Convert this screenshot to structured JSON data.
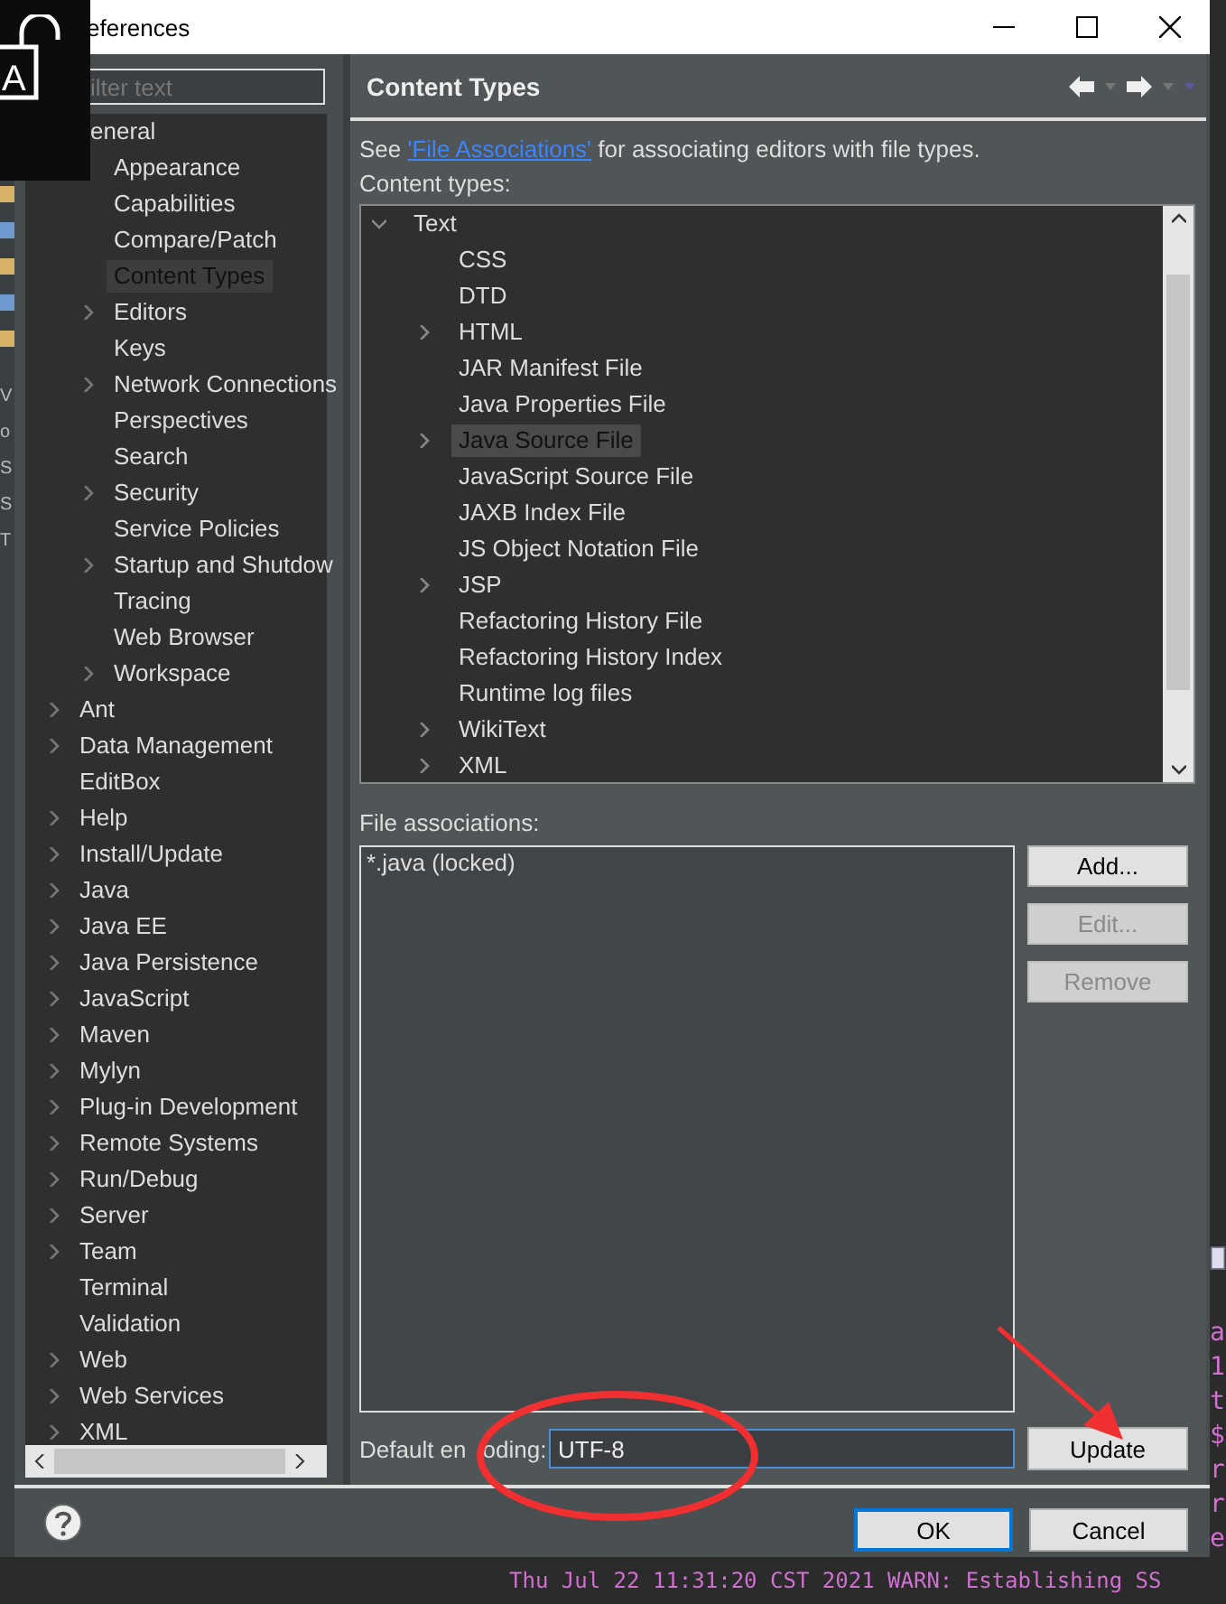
{
  "window": {
    "title": "eferences"
  },
  "overlay": {
    "letter": "A"
  },
  "left_edge_texts": [
    "V",
    "o",
    "S",
    "S",
    "T"
  ],
  "right_edge_texts": [
    "a",
    "1",
    "t",
    "$",
    "r",
    "r",
    "e"
  ],
  "console_line": "Thu Jul 22 11:31:20 CST 2021 WARN: Establishing SS",
  "filter": {
    "placeholder": "ilter text"
  },
  "settings_tree": [
    {
      "label": "eneral",
      "selected": false,
      "children": [
        {
          "label": "Appearance",
          "selected": false
        },
        {
          "label": "Capabilities",
          "selected": false
        },
        {
          "label": "Compare/Patch",
          "selected": false
        },
        {
          "label": "Content Types",
          "selected": true
        },
        {
          "label": "Editors",
          "expanded": false,
          "selected": false
        },
        {
          "label": "Keys",
          "selected": false
        },
        {
          "label": "Network Connections",
          "expanded": false,
          "selected": false
        },
        {
          "label": "Perspectives",
          "selected": false
        },
        {
          "label": "Search",
          "selected": false
        },
        {
          "label": "Security",
          "expanded": false,
          "selected": false
        },
        {
          "label": "Service Policies",
          "selected": false
        },
        {
          "label": "Startup and Shutdow",
          "expanded": false,
          "selected": false
        },
        {
          "label": "Tracing",
          "selected": false
        },
        {
          "label": "Web Browser",
          "selected": false
        },
        {
          "label": "Workspace",
          "expanded": false,
          "selected": false
        }
      ]
    },
    {
      "label": "Ant",
      "expanded": false,
      "selected": false
    },
    {
      "label": "Data Management",
      "expanded": false,
      "selected": false
    },
    {
      "label": "EditBox",
      "selected": false
    },
    {
      "label": "Help",
      "expanded": false,
      "selected": false
    },
    {
      "label": "Install/Update",
      "expanded": false,
      "selected": false
    },
    {
      "label": "Java",
      "expanded": false,
      "selected": false
    },
    {
      "label": "Java EE",
      "expanded": false,
      "selected": false
    },
    {
      "label": "Java Persistence",
      "expanded": false,
      "selected": false
    },
    {
      "label": "JavaScript",
      "expanded": false,
      "selected": false
    },
    {
      "label": "Maven",
      "expanded": false,
      "selected": false
    },
    {
      "label": "Mylyn",
      "expanded": false,
      "selected": false
    },
    {
      "label": "Plug-in Development",
      "expanded": false,
      "selected": false
    },
    {
      "label": "Remote Systems",
      "expanded": false,
      "selected": false
    },
    {
      "label": "Run/Debug",
      "expanded": false,
      "selected": false
    },
    {
      "label": "Server",
      "expanded": false,
      "selected": false
    },
    {
      "label": "Team",
      "expanded": false,
      "selected": false
    },
    {
      "label": "Terminal",
      "selected": false
    },
    {
      "label": "Validation",
      "selected": false
    },
    {
      "label": "Web",
      "expanded": false,
      "selected": false
    },
    {
      "label": "Web Services",
      "expanded": false,
      "selected": false
    },
    {
      "label": "XML",
      "expanded": false,
      "selected": false
    }
  ],
  "page": {
    "title": "Content Types",
    "intro": {
      "before": "See ",
      "link": "'File Associations'",
      "after": " for associating editors with file types."
    },
    "content_types_label": "Content types:",
    "content_types": [
      {
        "label": "Text",
        "expanded": true,
        "selected": false,
        "children": [
          {
            "label": "CSS",
            "selected": false
          },
          {
            "label": "DTD",
            "selected": false
          },
          {
            "label": "HTML",
            "expanded": false,
            "selected": false
          },
          {
            "label": "JAR Manifest File",
            "selected": false
          },
          {
            "label": "Java Properties File",
            "selected": false
          },
          {
            "label": "Java Source File",
            "expanded": false,
            "selected": true
          },
          {
            "label": "JavaScript Source File",
            "selected": false
          },
          {
            "label": "JAXB Index File",
            "selected": false
          },
          {
            "label": "JS Object Notation File",
            "selected": false
          },
          {
            "label": "JSP",
            "expanded": false,
            "selected": false
          },
          {
            "label": "Refactoring History File",
            "selected": false
          },
          {
            "label": "Refactoring History Index",
            "selected": false
          },
          {
            "label": "Runtime log files",
            "selected": false
          },
          {
            "label": "WikiText",
            "expanded": false,
            "selected": false
          },
          {
            "label": "XML",
            "expanded": false,
            "selected": false
          }
        ]
      }
    ],
    "file_associations_label": "File associations:",
    "file_associations": [
      "*.java (locked)"
    ],
    "side_buttons": [
      {
        "label": "Add...",
        "disabled": false
      },
      {
        "label": "Edit...",
        "disabled": true
      },
      {
        "label": "Remove",
        "disabled": true
      }
    ],
    "encoding": {
      "label_parts": [
        "Default en",
        "oding:"
      ],
      "value": "UTF-8",
      "button": "Update"
    }
  },
  "buttons": [
    "OK",
    "Cancel"
  ]
}
